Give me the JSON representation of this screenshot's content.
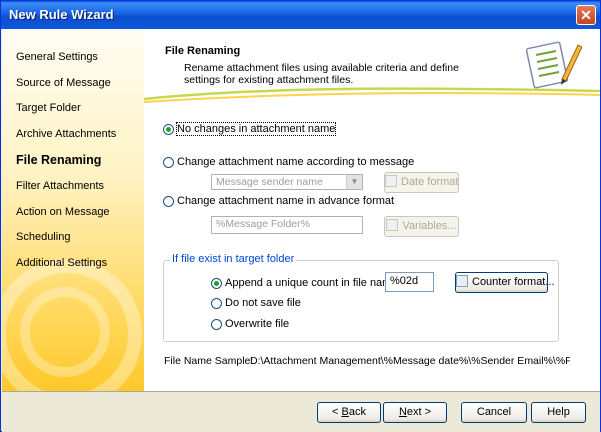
{
  "window": {
    "title": "New Rule Wizard",
    "close_symbol": "✕"
  },
  "sidebar": {
    "items": [
      {
        "label": "General Settings"
      },
      {
        "label": "Source of Message"
      },
      {
        "label": "Target Folder"
      },
      {
        "label": "Archive Attachments"
      },
      {
        "label": "File Renaming",
        "active": true
      },
      {
        "label": "Filter Attachments"
      },
      {
        "label": "Action on Message"
      },
      {
        "label": "Scheduling"
      },
      {
        "label": "Additional Settings"
      }
    ]
  },
  "header": {
    "title": "File Renaming",
    "description": "Rename attachment files using available criteria and define settings for existing attachment files.",
    "icon": "wizard-notepad-pencil-icon"
  },
  "options": {
    "no_change": "No changes in attachment name",
    "by_message": "Change attachment name according to message",
    "message_combo": "Message sender name",
    "date_format_btn": "Date format",
    "advanced": "Change attachment name in advance format",
    "advanced_input": "%Message Folder%",
    "variables_btn": "Variables...",
    "selected": "no_change"
  },
  "exist_group": {
    "legend": "If file exist in target folder",
    "append_count": "Append a unique count in file name",
    "count_value": "%02d",
    "counter_format_btn": "Counter format...",
    "do_not_save": "Do not save file",
    "overwrite": "Overwrite file",
    "selected": "append_count"
  },
  "sample": {
    "label": "File Name Sample:",
    "value": "D:\\Attachment Management\\%Message date%\\%Sender Email%\\%File Nam"
  },
  "footer": {
    "back_prefix": "< ",
    "back_key": "B",
    "back_rest": "ack",
    "next_key": "N",
    "next_rest": "ext >",
    "cancel": "Cancel",
    "help": "Help"
  }
}
